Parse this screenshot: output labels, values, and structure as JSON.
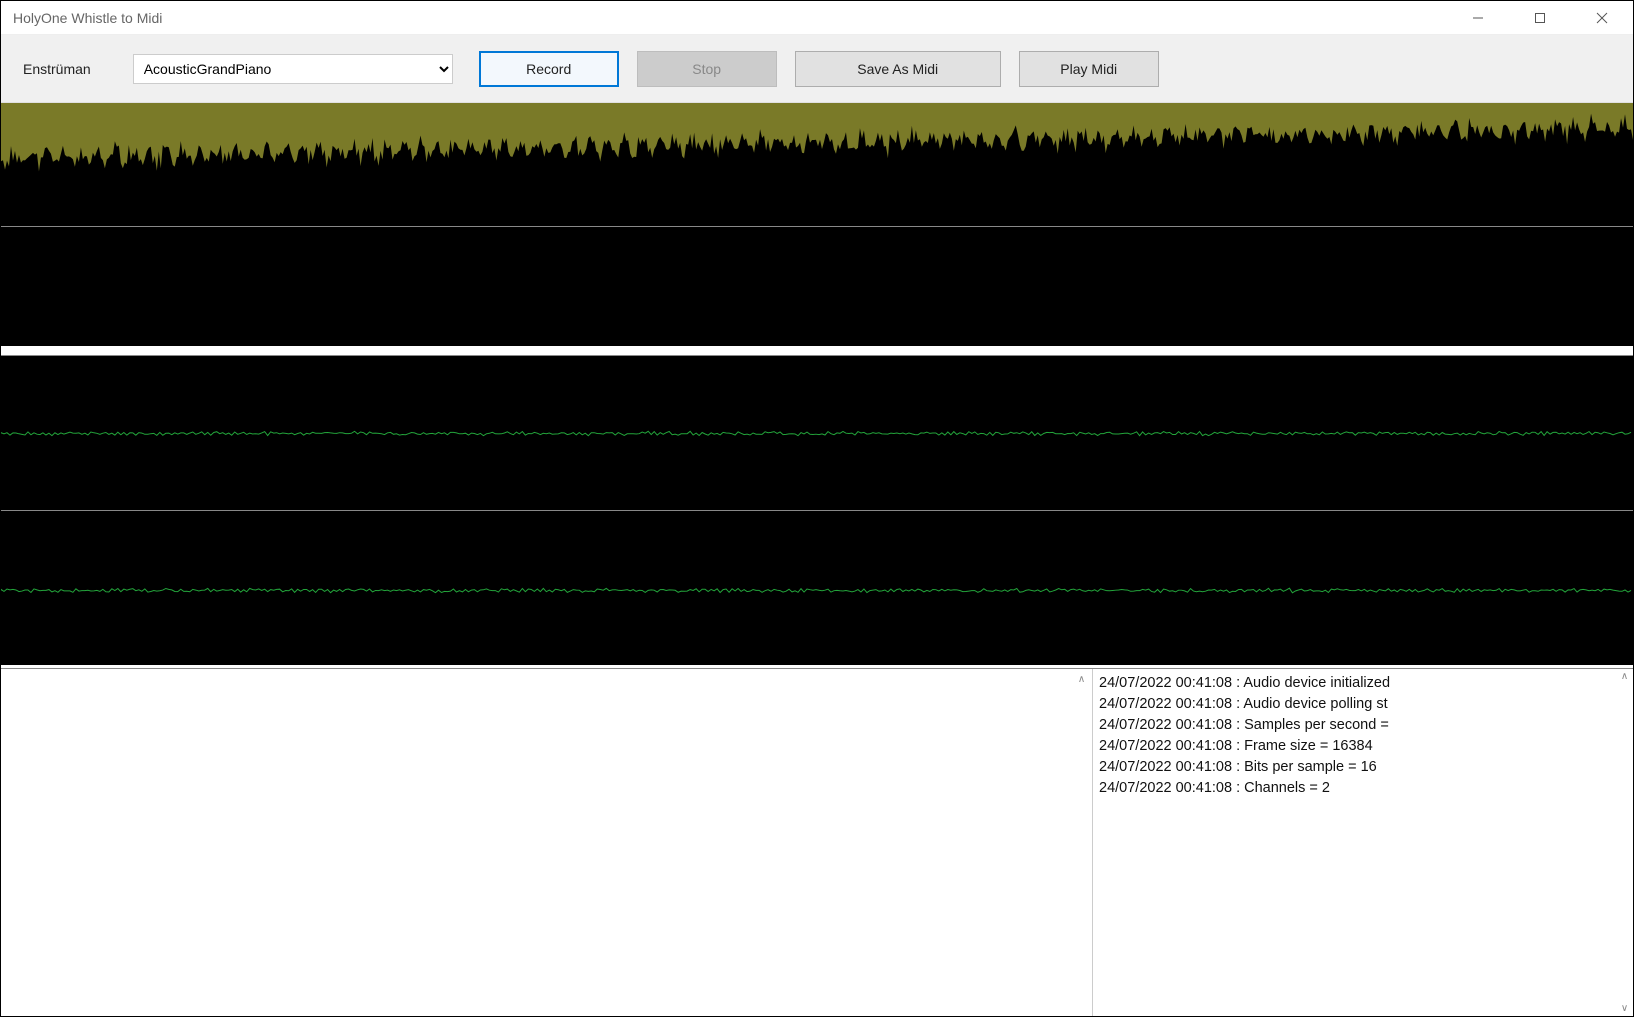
{
  "window": {
    "title": "HolyOne Whistle to Midi"
  },
  "toolbar": {
    "instrument_label": "Enstrüman",
    "instrument_selected": "AcousticGrandPiano",
    "record_label": "Record",
    "stop_label": "Stop",
    "save_label": "Save As Midi",
    "play_label": "Play Midi"
  },
  "visualization": {
    "pane1": {
      "bg_color": "#7a7a28",
      "waveform_color": "#000000"
    },
    "pane3": {
      "line_color": "#23a53b"
    },
    "pane4": {
      "line_color": "#23a53b"
    }
  },
  "log": {
    "lines": [
      "24/07/2022 00:41:08 : Audio device initialized",
      "24/07/2022 00:41:08 : Audio device polling st",
      "24/07/2022 00:41:08 : Samples per second =",
      "24/07/2022 00:41:08 : Frame size = 16384",
      "24/07/2022 00:41:08 : Bits per sample = 16",
      "24/07/2022 00:41:08 : Channels = 2"
    ]
  }
}
